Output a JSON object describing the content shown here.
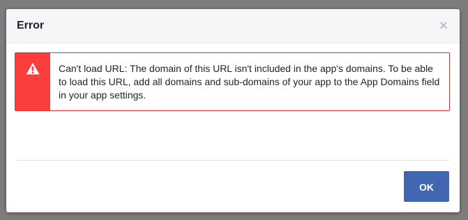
{
  "dialog": {
    "title": "Error",
    "close_icon": "close-icon",
    "close_glyph": "×",
    "error": {
      "icon": "warning-triangle-icon",
      "message": "Can't load URL: The domain of this URL isn't included in the app's domains. To be able to load this URL, add all domains and sub-domains of your app to the App Domains field in your app settings."
    },
    "ok_label": "OK"
  },
  "colors": {
    "accent": "#4267b2",
    "error_red": "#fa3e3e",
    "error_border": "#e02f33",
    "header_bg": "#f5f6f7"
  }
}
